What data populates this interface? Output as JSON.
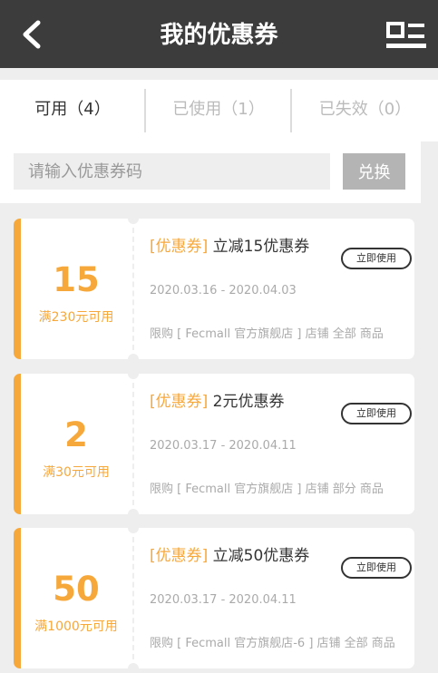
{
  "header": {
    "title": "我的优惠券",
    "back_icon": "chevron-left-icon",
    "menu_icon": "menu-icon"
  },
  "tabs": [
    {
      "label": "可用（4）",
      "active": true
    },
    {
      "label": "已使用（1）",
      "active": false
    },
    {
      "label": "已失效（0）",
      "active": false
    }
  ],
  "search": {
    "placeholder": "请输入优惠券码",
    "value": "",
    "button_label": "兑换"
  },
  "colors": {
    "header_bg": "#3c3c3c",
    "accent": "#f7a83b",
    "redeem_button": "#b4b4b4"
  },
  "coupons": [
    {
      "amount": "15",
      "condition": "满230元可用",
      "tag": "[优惠券]",
      "name": " 立减15优惠券",
      "button_label": "立即使用",
      "date_range": "2020.03.16 - 2020.04.03",
      "scope": "限购 [ Fecmall 官方旗舰店 ] 店铺 全部 商品"
    },
    {
      "amount": "2",
      "condition": "满30元可用",
      "tag": "[优惠券]",
      "name": " 2元优惠券",
      "button_label": "立即使用",
      "date_range": "2020.03.17 - 2020.04.11",
      "scope": "限购 [ Fecmall 官方旗舰店 ] 店铺 部分 商品"
    },
    {
      "amount": "50",
      "condition": "满1000元可用",
      "tag": "[优惠券]",
      "name": " 立减50优惠券",
      "button_label": "立即使用",
      "date_range": "2020.03.17 - 2020.04.11",
      "scope": "限购 [ Fecmall 官方旗舰店-6 ] 店铺 全部 商品"
    }
  ]
}
